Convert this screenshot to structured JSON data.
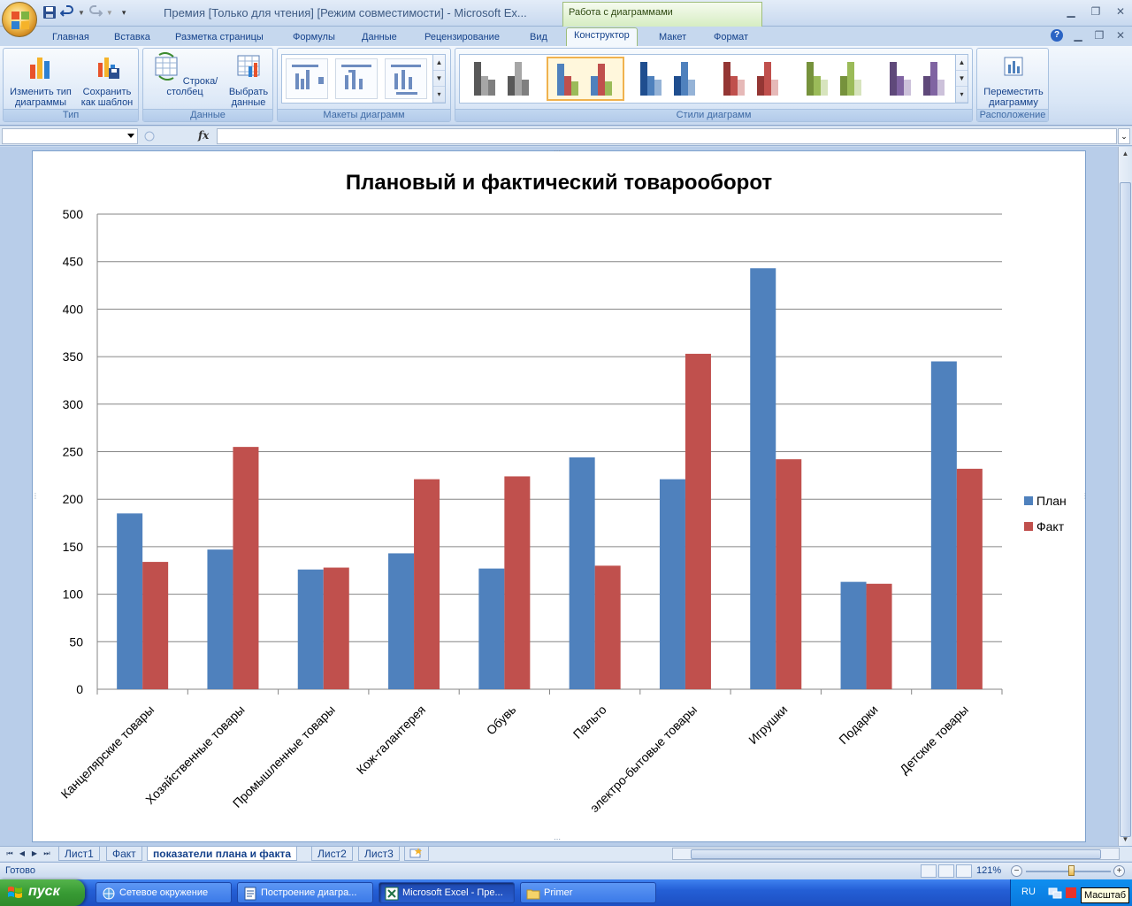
{
  "window": {
    "title": "Премия  [Только для чтения]  [Режим совместимости]  -  Microsoft Ex...",
    "context_tools": "Работа с диаграммами"
  },
  "tabs": [
    "Главная",
    "Вставка",
    "Разметка страницы",
    "Формулы",
    "Данные",
    "Рецензирование",
    "Вид",
    "Конструктор",
    "Макет",
    "Формат"
  ],
  "active_tab": "Конструктор",
  "ribbon": {
    "groups": {
      "type": {
        "label": "Тип",
        "change_type": "Изменить тип диаграммы",
        "save_template": "Сохранить как шаблон"
      },
      "data": {
        "label": "Данные",
        "switch_row_col": "Строка/столбец",
        "select_data": "Выбрать данные"
      },
      "layouts": {
        "label": "Макеты диаграмм"
      },
      "styles": {
        "label": "Стили диаграмм"
      },
      "location": {
        "label": "Расположение",
        "move_chart": "Переместить диаграмму"
      }
    }
  },
  "formula_bar": {
    "name_box": "",
    "fx": "fx",
    "formula": ""
  },
  "chart_data": {
    "type": "bar",
    "title": "Плановый и фактический товарооборот",
    "xlabel": "",
    "ylabel": "",
    "ylim": [
      0,
      500
    ],
    "yticks": [
      0,
      50,
      100,
      150,
      200,
      250,
      300,
      350,
      400,
      450,
      500
    ],
    "grid": true,
    "legend_position": "right",
    "categories": [
      "Канцелярские товары",
      "Хозяйственные товары",
      "Промышленные товары",
      "Кож-галантерея",
      "Обувь",
      "Пальто",
      "электро-бытовые товары",
      "Игрушки",
      "Подарки",
      "Детские товары"
    ],
    "series": [
      {
        "name": "План",
        "color": "#4f81bd",
        "values": [
          185,
          147,
          126,
          143,
          127,
          244,
          221,
          443,
          113,
          345
        ]
      },
      {
        "name": "Факт",
        "color": "#c0504d",
        "values": [
          134,
          255,
          128,
          221,
          224,
          130,
          353,
          242,
          111,
          232
        ]
      }
    ]
  },
  "sheet_tabs": [
    "Лист1",
    "Факт",
    "показатели плана и факта",
    "Лист2",
    "Лист3"
  ],
  "active_sheet": "показатели плана и факта",
  "status": {
    "text": "Готово",
    "zoom": "121%",
    "zoom_level_pct": 121
  },
  "taskbar": {
    "start": "пуск",
    "tasks": [
      "Сетевое окружение",
      "Построение диагра...",
      "Microsoft Excel - Пре...",
      "Primer"
    ],
    "active_task": "Microsoft Excel - Пре...",
    "lang": "RU",
    "tooltip": "Масштаб"
  }
}
